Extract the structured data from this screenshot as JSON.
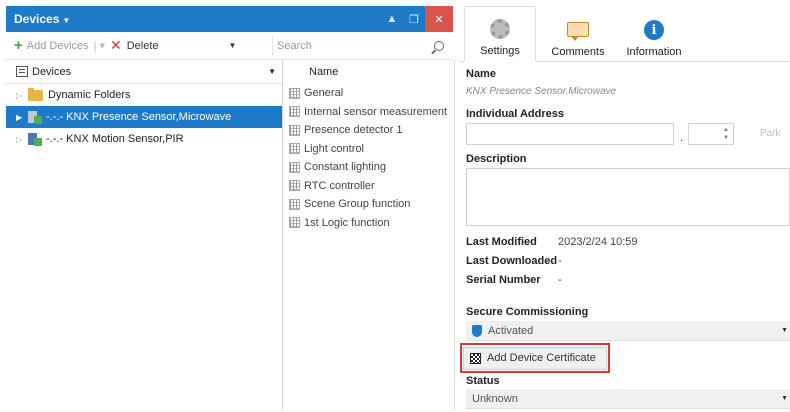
{
  "window": {
    "title": "Devices"
  },
  "toolbar": {
    "add_label": "Add Devices",
    "delete_label": "Delete",
    "search_placeholder": "Search"
  },
  "tree": {
    "header": "Devices",
    "items": [
      {
        "label": "Dynamic Folders"
      },
      {
        "label": "-.-.- KNX Presence Sensor,Microwave"
      },
      {
        "label": "-.-.- KNX Motion Sensor,PIR"
      }
    ]
  },
  "params": {
    "header": "Name",
    "items": [
      "General",
      "Internal sensor measurement",
      "Presence detector 1",
      "Light control",
      "Constant lighting",
      "RTC controller",
      "Scene Group function",
      "1st Logic function"
    ]
  },
  "tabs": [
    {
      "label": "Settings"
    },
    {
      "label": "Comments"
    },
    {
      "label": "Information"
    }
  ],
  "props": {
    "name_label": "Name",
    "name_value": "KNX Presence Sensor,Microwave",
    "address_label": "Individual Address",
    "address_dot": ".",
    "free_label": "Park",
    "description_label": "Description",
    "last_modified_label": "Last Modified",
    "last_modified_value": "2023/2/24 10:59",
    "last_downloaded_label": "Last Downloaded",
    "last_downloaded_value": "-",
    "serial_label": "Serial Number",
    "serial_value": "-",
    "secure_label": "Secure Commissioning",
    "secure_value": "Activated",
    "cert_button": "Add Device Certificate",
    "status_label": "Status",
    "status_value": "Unknown"
  }
}
